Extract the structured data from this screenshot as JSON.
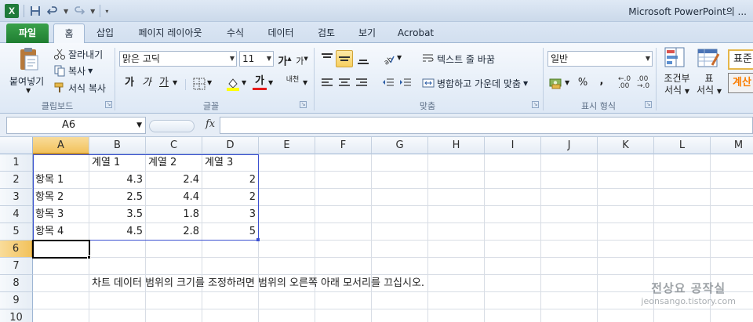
{
  "window": {
    "app_logo": "X",
    "title": "Microsoft PowerPoint의 ..."
  },
  "ribbon_tabs": [
    "파일",
    "홈",
    "삽입",
    "페이지 레이아웃",
    "수식",
    "데이터",
    "검토",
    "보기",
    "Acrobat"
  ],
  "clipboard": {
    "paste": "붙여넣기",
    "cut": "잘라내기",
    "copy": "복사",
    "format_painter": "서식 복사",
    "label": "클립보드"
  },
  "font": {
    "name": "맑은 고딕",
    "size": "11",
    "bold": "가",
    "italic": "가",
    "underline": "가",
    "grow": "가",
    "shrink": "가",
    "phonetic": "내천",
    "label": "글꼴"
  },
  "alignment": {
    "wrap_text": "텍스트 줄 바꿈",
    "merge_center": "병합하고 가운데 맞춤",
    "label": "맞춤"
  },
  "number": {
    "format": "일반",
    "percent": "%",
    "comma": ",",
    "label": "표시 형식"
  },
  "styles": {
    "conditional": "조건부",
    "conditional_sub": "서식",
    "table": "표",
    "table_sub": "서식",
    "style_normal": "표준",
    "style_calc": "계산"
  },
  "formula_bar": {
    "name_box": "A6",
    "fx": "fx",
    "content": ""
  },
  "columns": [
    "A",
    "B",
    "C",
    "D",
    "E",
    "F",
    "G",
    "H",
    "I",
    "J",
    "K",
    "L",
    "M"
  ],
  "rows": [
    "1",
    "2",
    "3",
    "4",
    "5",
    "6",
    "7",
    "8",
    "9",
    "10"
  ],
  "sheet": {
    "header": [
      "",
      "계열 1",
      "계열 2",
      "계열 3"
    ],
    "data": [
      [
        "항목 1",
        "4.3",
        "2.4",
        "2"
      ],
      [
        "항목 2",
        "2.5",
        "4.4",
        "2"
      ],
      [
        "항목 3",
        "3.5",
        "1.8",
        "3"
      ],
      [
        "항목 4",
        "4.5",
        "2.8",
        "5"
      ]
    ],
    "note": "차트 데이터 범위의 크기를 조정하려면 범위의 오른쪽 아래 모서리를 끄십시오."
  },
  "watermark": {
    "main": "전상요 공작실",
    "sub": "jeonsango.tistory.com"
  },
  "colors": {
    "file_tab": "#2a8d3c",
    "selection_header": "#f2c25c",
    "chart_range": "#3a4fd0"
  }
}
